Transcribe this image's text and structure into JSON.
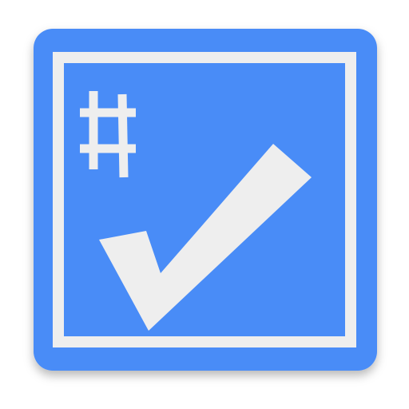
{
  "icon": {
    "name": "hash-checkbox-app-icon",
    "glyph": "#",
    "glyph_icon": "hash-icon",
    "mark_icon": "checkmark-icon",
    "colors": {
      "tile": "#4a8cf7",
      "border": "#eeeeee",
      "checkmark": "#eeeeee",
      "hash": "#eeeeee",
      "shadow": "#bdbdbd"
    }
  }
}
